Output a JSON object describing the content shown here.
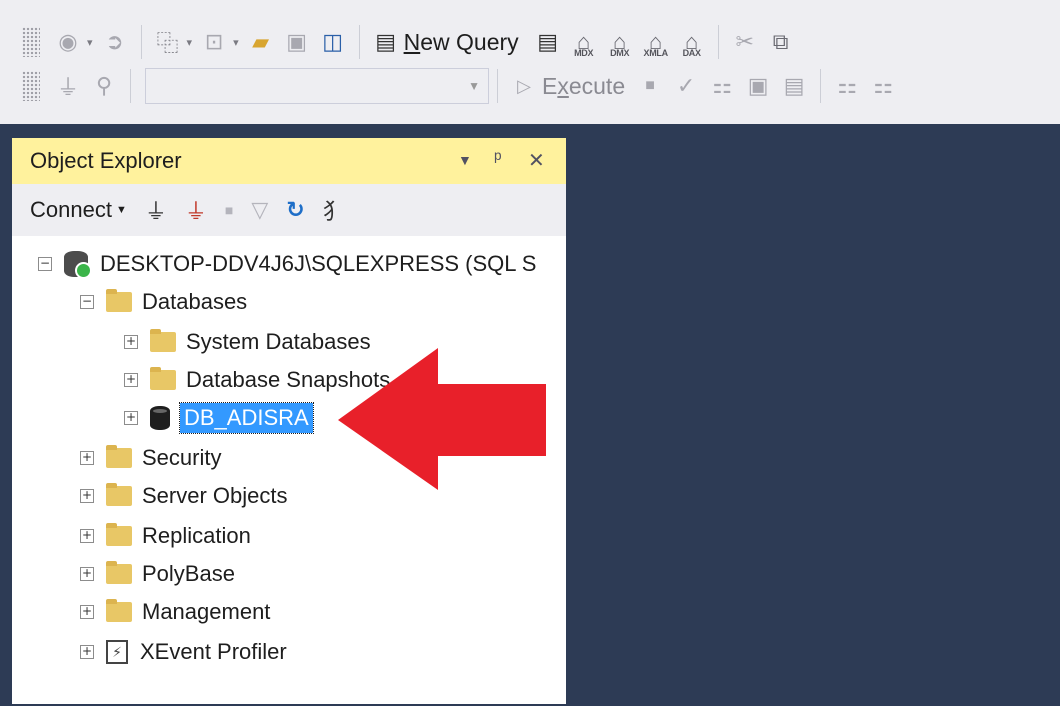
{
  "toolbar1": {
    "new_query_prefix": "",
    "new_query_underlined": "N",
    "new_query_rest": "ew Query",
    "mdx_label": "MDX",
    "dmx_label": "DMX",
    "xmla_label": "XMLA",
    "dax_label": "DAX"
  },
  "toolbar2": {
    "database_selector_value": "",
    "execute_prefix": "E",
    "execute_underlined": "x",
    "execute_rest": "ecute"
  },
  "object_explorer": {
    "title": "Object Explorer",
    "connect_label": "Connect",
    "tree": [
      {
        "label": "DESKTOP-DDV4J6J\\SQLEXPRESS (SQL S",
        "expanded": true
      },
      {
        "label": "Databases",
        "expanded": true
      },
      {
        "label": "System Databases",
        "expanded": false
      },
      {
        "label": "Database Snapshots",
        "expanded": false
      },
      {
        "label": "DB_ADISRA",
        "expanded": false,
        "selected": true
      },
      {
        "label": "Security",
        "expanded": false
      },
      {
        "label": "Server Objects",
        "expanded": false
      },
      {
        "label": "Replication",
        "expanded": false
      },
      {
        "label": "PolyBase",
        "expanded": false
      },
      {
        "label": "Management",
        "expanded": false
      },
      {
        "label": "XEvent Profiler",
        "expanded": false
      }
    ]
  },
  "colors": {
    "workspace_bg": "#2d3b55",
    "title_bar_active": "#fff29d",
    "selection": "#3399ff",
    "annotation_arrow": "#e8202a"
  }
}
